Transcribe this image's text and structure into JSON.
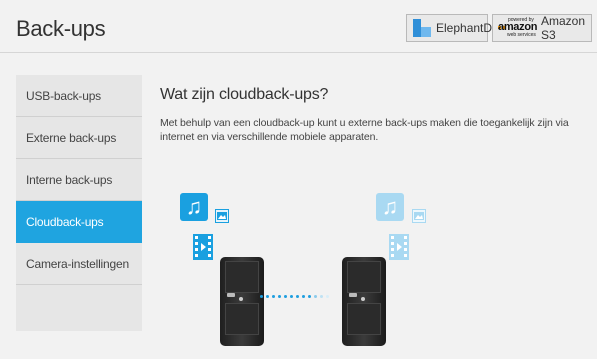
{
  "header": {
    "title": "Back-ups",
    "providers": [
      {
        "label": "ElephantDrive",
        "icon": "elephantdrive-logo-icon"
      },
      {
        "label": "Amazon S3",
        "icon": "amazon-web-services-logo-icon",
        "logo_text": "amazon",
        "logo_top": "powered by",
        "logo_bottom": "web services"
      }
    ]
  },
  "sidebar": {
    "items": [
      {
        "label": "USB-back-ups",
        "active": false
      },
      {
        "label": "Externe back-ups",
        "active": false
      },
      {
        "label": "Interne back-ups",
        "active": false
      },
      {
        "label": "Cloudback-ups",
        "active": true
      },
      {
        "label": "Camera-instellingen",
        "active": false
      }
    ]
  },
  "main": {
    "heading": "Wat zijn cloudback-ups?",
    "description": "Met behulp van een cloudback-up kunt u externe back-ups maken die toegankelijk zijn via internet en via verschillende mobiele apparaten."
  },
  "colors": {
    "accent": "#1fa4e0",
    "background": "#f2f2f2",
    "sidebar_bg": "#e6e6e6"
  }
}
